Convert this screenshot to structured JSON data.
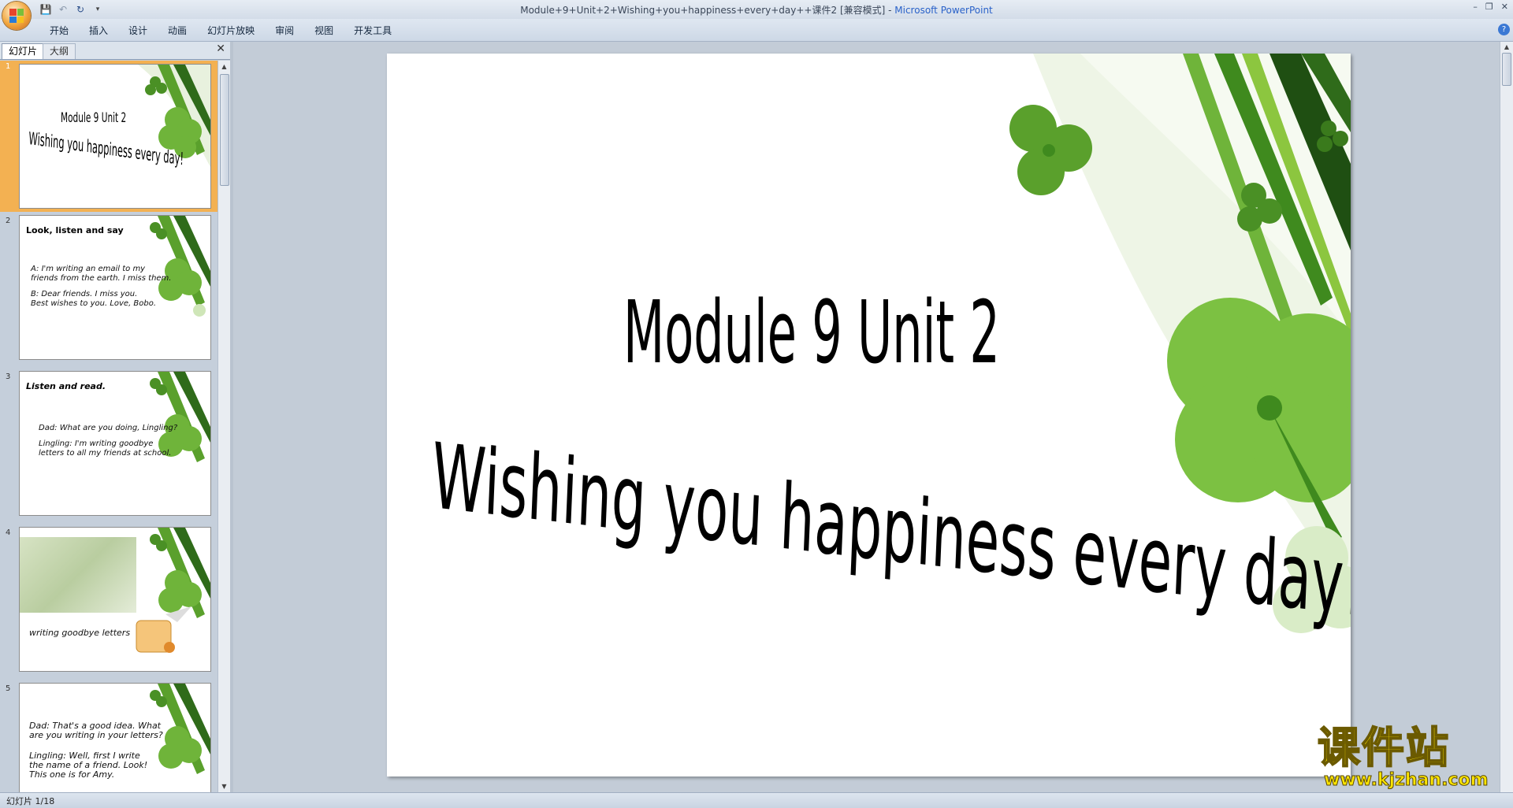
{
  "window": {
    "title": "Module+9+Unit+2+Wishing+you+happiness+every+day++课件2 [兼容模式] - ",
    "app_name": "Microsoft PowerPoint",
    "controls": [
      "–",
      "❐",
      "✕"
    ]
  },
  "qat": {
    "save": "💾",
    "undo": "↶",
    "redo": "↻",
    "more": "▾"
  },
  "menu": [
    "开始",
    "插入",
    "设计",
    "动画",
    "幻灯片放映",
    "审阅",
    "视图",
    "开发工具"
  ],
  "help_label": "?",
  "panel": {
    "tabs": [
      "幻灯片",
      "大纲"
    ],
    "close": "✕"
  },
  "slides": [
    {
      "num": "1",
      "line1": "Module 9 Unit 2",
      "line2": "Wishing you happiness every day!"
    },
    {
      "num": "2",
      "heading": "Look, listen and say",
      "a": "A: I'm writing an email to my friends from the earth. I miss them.",
      "b": "B: Dear friends. I miss you. Best wishes to you. Love, Bobo."
    },
    {
      "num": "3",
      "heading": "Listen and read.",
      "a": "Dad: What are you doing, Lingling?",
      "b": "Lingling: I'm writing goodbye letters to all my friends at school."
    },
    {
      "num": "4",
      "caption": "writing goodbye letters"
    },
    {
      "num": "5",
      "a": "Dad: That's a good idea. What are you writing in your letters?",
      "b": "Lingling: Well, first I write the name of a friend. Look! This one is for Amy."
    }
  ],
  "main_slide": {
    "line1": "Module 9 Unit 2",
    "line2": "Wishing you happiness every day!"
  },
  "status": "幻灯片 1/18",
  "watermark": {
    "main": "课件站",
    "url": "www.kjzhan.com"
  },
  "colors": {
    "accent": "#f3b152",
    "clover_dark": "#3f8a1e",
    "clover_light": "#8cc63f",
    "watermark": "#ffe600"
  }
}
